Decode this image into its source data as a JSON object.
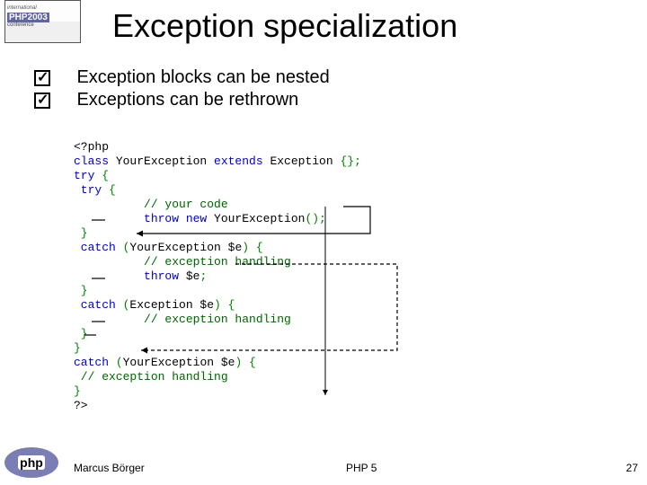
{
  "slide": {
    "title": "Exception specialization",
    "bullets": [
      "Exception blocks can be nested",
      "Exceptions can be rethrown"
    ],
    "code": {
      "l1": "<?php",
      "l2a": "class ",
      "l2b": "YourException ",
      "l2c": "extends ",
      "l2d": "Exception ",
      "l2e": "{};",
      "l3a": "try ",
      "l3b": "{",
      "l4a": " try ",
      "l4b": "{",
      "l5": "          // your code",
      "l6a": "          throw new ",
      "l6b": "YourException",
      "l6c": "();",
      "l7": " }",
      "l8a": " catch ",
      "l8b": "(",
      "l8c": "YourException $e",
      "l8d": ") {",
      "l9": "          // exception handling",
      "l10a": "          throw ",
      "l10b": "$e",
      "l10c": ";",
      "l11": " }",
      "l12a": " catch ",
      "l12b": "(",
      "l12c": "Exception $e",
      "l12d": ") {",
      "l13": "          // exception handling",
      "l14": " }",
      "l15": "}",
      "l16a": "catch ",
      "l16b": "(",
      "l16c": "YourException $e",
      "l16d": ") {",
      "l17": " // exception handling",
      "l18": "}",
      "l19": "?>"
    }
  },
  "logo_top": {
    "line1": "international",
    "line2": "PHP2003",
    "line3": "conference"
  },
  "logo_bottom": "php",
  "footer": {
    "author": "Marcus Börger",
    "mid": "PHP 5",
    "page": "27"
  }
}
